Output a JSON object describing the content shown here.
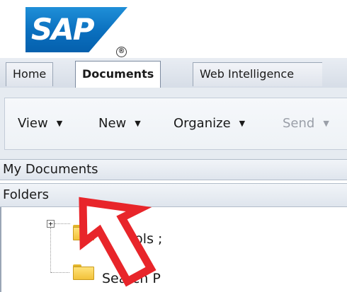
{
  "brand": {
    "logo_text": "SAP",
    "registered_mark": "®"
  },
  "tabs": [
    {
      "label": "Home",
      "active": false
    },
    {
      "label": "Documents",
      "active": true
    },
    {
      "label": "Web Intelligence",
      "active": false
    }
  ],
  "toolbar": {
    "view_label": "View",
    "new_label": "New",
    "organize_label": "Organize",
    "send_label": "Send",
    "caret_glyph": "▼"
  },
  "panels": {
    "my_documents_label": "My Documents",
    "folders_label": "Folders"
  },
  "tree": {
    "expander_glyph": "+",
    "nodes": [
      {
        "label": "Schools ;"
      },
      {
        "label": "Search P"
      }
    ]
  },
  "annotation": {
    "color": "#e8252a",
    "icon": "red-arrow-pointing-up-left"
  }
}
